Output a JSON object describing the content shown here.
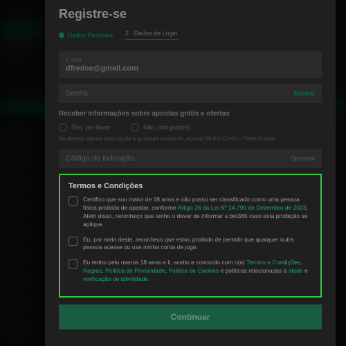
{
  "modal": {
    "title": "Registre-se",
    "steps": {
      "step1": "Dados Pessoais",
      "step2_num": "2.",
      "step2": "Dados de Login"
    },
    "email": {
      "label": "E-mail",
      "value": "dfredse@gmail.com"
    },
    "senha": {
      "placeholder": "Senha",
      "action": "Mostrar"
    },
    "offers": {
      "heading": "Receber informações sobre apostas grátis e ofertas",
      "yes": "Sim, por favor",
      "no": "Não, obrigado(a)",
      "hint": "Se desejar alterar esta opção a qualquer momento, acesse Minha Conta > Preferências."
    },
    "referral": {
      "placeholder": "Código de indicação",
      "optional": "Opcional"
    },
    "terms": {
      "title": "Termos e Condições",
      "t1_a": "Certifico que sou maior de 18 anos e não posso ser classificado como uma pessoa física proibida de apostar, conforme ",
      "t1_link": "Artigo 26 da Lei Nº 14.790 de Dezembro de 2023",
      "t1_b": ". Além disso, reconheço que tenho o dever de informar a bet365 caso esta proibição se aplique.",
      "t2": "Eu, por meio deste, reconheço que estou proibido de permitir que qualquer outra pessoa acesse ou use minha conta de jogo.",
      "t3_a": "Eu tenho pelo menos 18 anos e li, aceito e concordo com o(a) ",
      "t3_l1": "Termos e Condições",
      "t3_s1": ", ",
      "t3_l2": "Regras",
      "t3_s2": ", ",
      "t3_l3": "Política de Privacidade",
      "t3_s3": ", ",
      "t3_l4": "Política de Cookies",
      "t3_b": " e políticas relacionadas à ",
      "t3_l5": "idade",
      "t3_c": " e ",
      "t3_l6": "verificação de identidade",
      "t3_d": "."
    },
    "continue": "Continuar"
  }
}
